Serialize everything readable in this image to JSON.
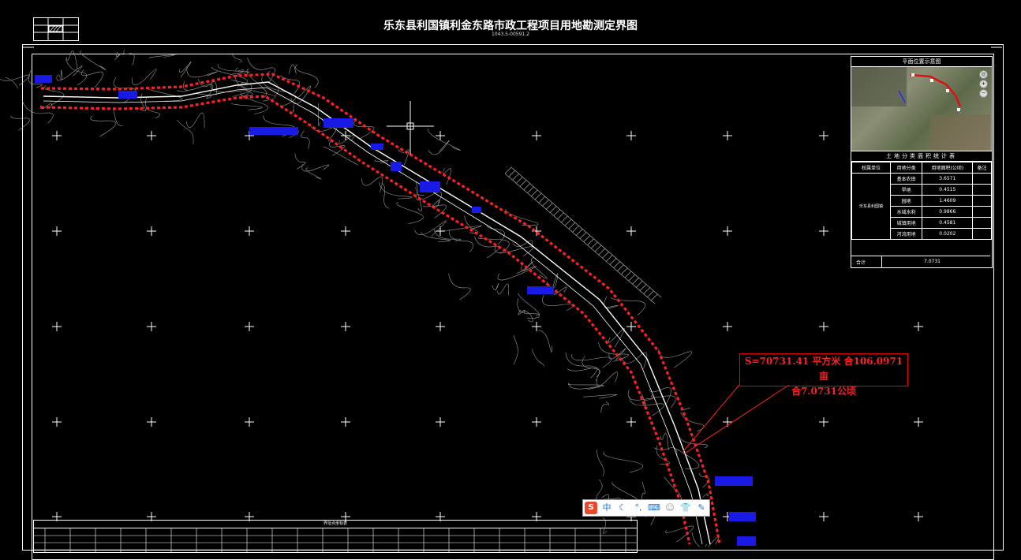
{
  "title": "乐东县利国镇利金东路市政工程项目用地勘测定界图",
  "subtitle": "1043.5-00591.2",
  "inset": {
    "location_header": "平面位置示意图",
    "stats_header": "土地分类面积统计表",
    "columns": [
      "权属单位",
      "用地分类",
      "用地面积(公顷)",
      "备注"
    ],
    "owner": "乐东县利国镇",
    "rows": [
      {
        "type": "基本农田",
        "area": "3.6571"
      },
      {
        "type": "旱地",
        "area": "0.4515"
      },
      {
        "type": "园地",
        "area": "1.4609"
      },
      {
        "type": "水域水利",
        "area": "0.9866"
      },
      {
        "type": "城镇用地",
        "area": "0.4581"
      },
      {
        "type": "河流用地",
        "area": "0.0202"
      }
    ],
    "total_label": "合计",
    "total_value": "7.0731"
  },
  "annotation": {
    "line1": "S=70731.41 平方米 合106.0971亩",
    "line2": "合7.0731公顷"
  },
  "bottom_table": {
    "title": "界址点坐标表"
  },
  "ime_toolbar": {
    "logo": "S",
    "mode": "中",
    "icons": [
      "moon-icon",
      "punctuation-icon",
      "keyboard-icon",
      "user-icon",
      "skin-icon",
      "tools-icon"
    ]
  },
  "colors": {
    "background": "#000000",
    "boundary": "#ff2020",
    "road": "#ffffff",
    "water": "#1010e0"
  }
}
